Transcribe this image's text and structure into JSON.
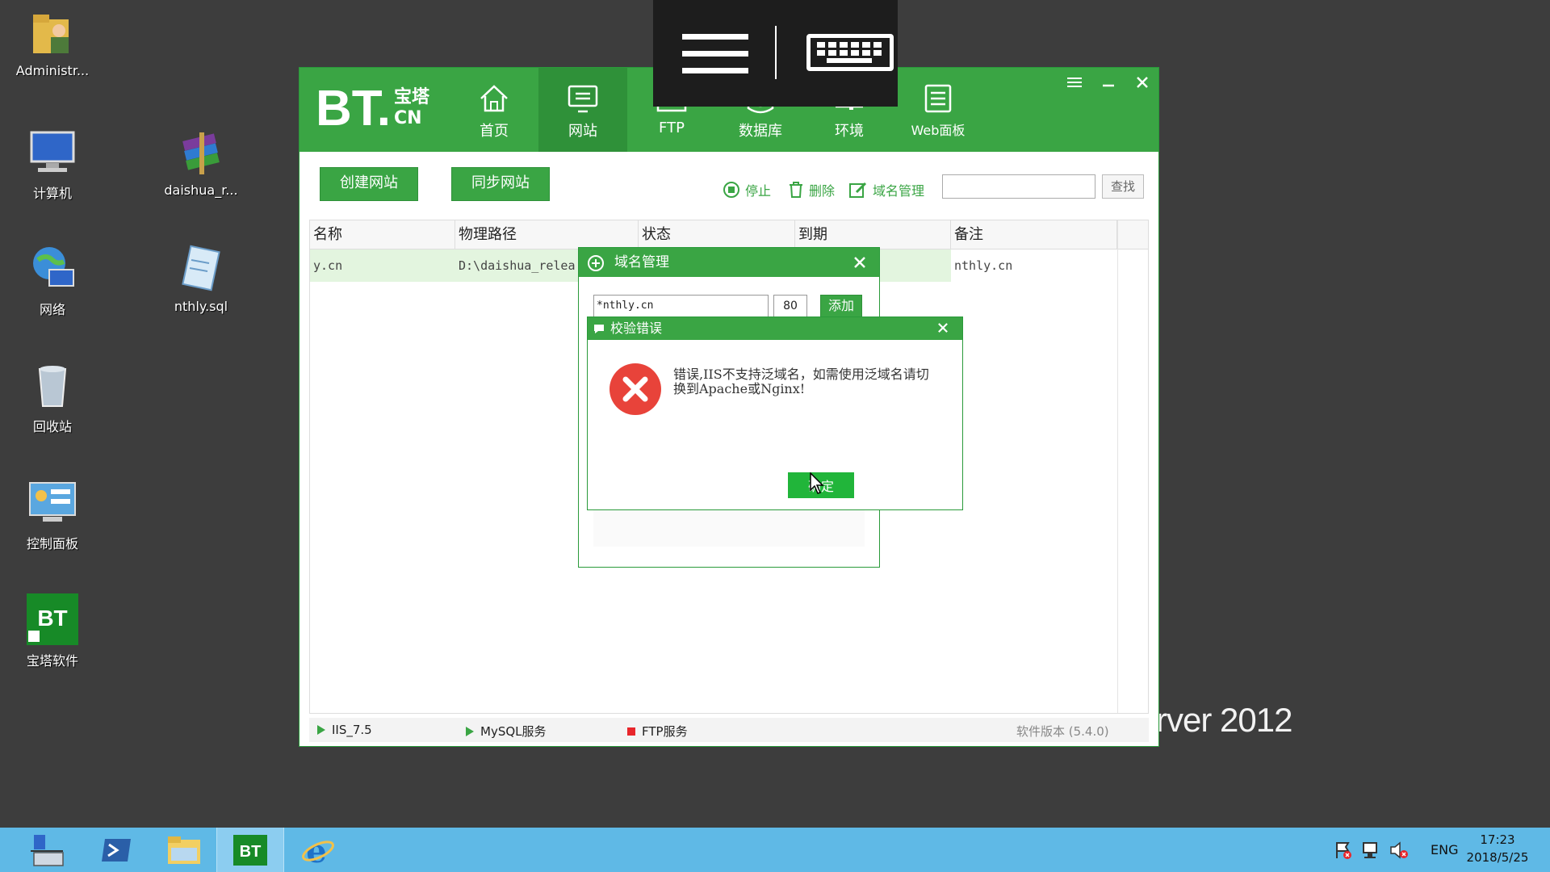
{
  "desktop": {
    "icons": [
      {
        "label": "Administr..."
      },
      {
        "label": "计算机"
      },
      {
        "label": "daishua_r..."
      },
      {
        "label": "网络"
      },
      {
        "label": "nthly.sql"
      },
      {
        "label": "回收站"
      },
      {
        "label": "控制面板"
      },
      {
        "label": "宝塔软件"
      }
    ],
    "os_watermark": "rver 2012"
  },
  "app": {
    "logo_main": "BT.",
    "logo_cn_line1": "宝塔",
    "logo_cn_line2": "CN",
    "nav": [
      {
        "label": "首页"
      },
      {
        "label": "网站"
      },
      {
        "label": "FTP"
      },
      {
        "label": "数据库"
      },
      {
        "label": "环境"
      },
      {
        "label": "Web面板"
      }
    ],
    "toolbar": {
      "create_site": "创建网站",
      "sync_site": "同步网站",
      "stop": "停止",
      "delete": "删除",
      "domain_manage": "域名管理",
      "search_value": "",
      "search_button": "查找"
    },
    "table": {
      "headers": [
        "名称",
        "物理路径",
        "状态",
        "到期",
        "备注"
      ],
      "rows": [
        {
          "name": "y.cn",
          "path": "D:\\daishua_relea",
          "status": "",
          "expire": "",
          "note": "nthly.cn"
        }
      ]
    },
    "status_bar": {
      "iis": "IIS_7.5",
      "mysql": "MySQL服务",
      "ftp": "FTP服务",
      "version": "软件版本 (5.4.0)"
    },
    "colors": {
      "brand": "#3aa544",
      "active_nav": "#2f9139",
      "ftp_stopped": "#e8262b"
    }
  },
  "domain_dialog": {
    "title": "域名管理",
    "domain_value": "*nthly.cn",
    "port_value": "80",
    "add_button": "添加"
  },
  "error_dialog": {
    "title": "校验错误",
    "message": "错误,IIS不支持泛域名，如需使用泛域名请切换到Apache或Nginx!",
    "ok_button": "确定"
  },
  "taskbar": {
    "lang": "ENG",
    "time": "17:23",
    "date": "2018/5/25"
  }
}
